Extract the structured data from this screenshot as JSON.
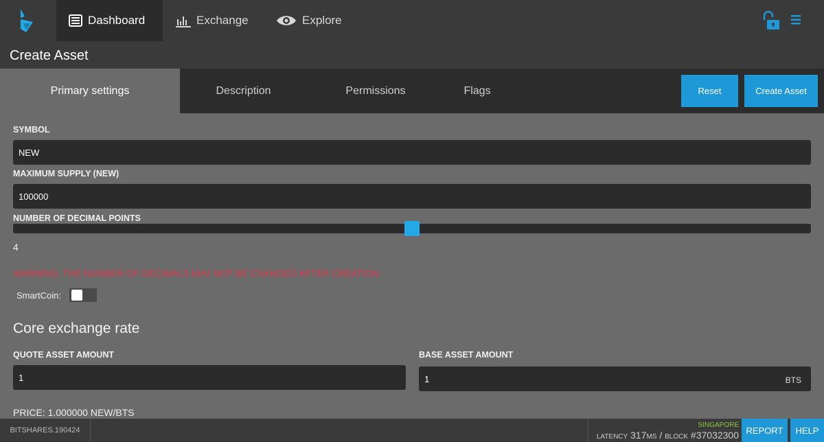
{
  "nav": {
    "items": [
      {
        "label": "Dashboard",
        "icon": "dashboard-icon",
        "active": true
      },
      {
        "label": "Exchange",
        "icon": "exchange-chart-icon",
        "active": false
      },
      {
        "label": "Explore",
        "icon": "eye-icon",
        "active": false
      }
    ],
    "lock_icon": "unlocked-padlock-icon",
    "menu_icon": "hamburger-menu-icon"
  },
  "page": {
    "title": "Create Asset"
  },
  "tabs": [
    {
      "label": "Primary settings",
      "active": true
    },
    {
      "label": "Description",
      "active": false
    },
    {
      "label": "Permissions",
      "active": false
    },
    {
      "label": "Flags",
      "active": false
    }
  ],
  "actions": {
    "reset": "Reset",
    "create": "Create Asset"
  },
  "form": {
    "symbol": {
      "label": "SYMBOL",
      "value": "NEW"
    },
    "max_supply": {
      "label": "MAXIMUM SUPPLY (NEW)",
      "value": "100000"
    },
    "decimals": {
      "label": "NUMBER OF DECIMAL POINTS",
      "value": "4",
      "slider_fraction": 0.5
    },
    "warning": "WARNING: THE NUMBER OF DECIMALS MAY NOT BE CHANGED AFTER CREATION",
    "smartcoin": {
      "label": "SmartCoin:",
      "enabled": false
    }
  },
  "core_exchange": {
    "title": "Core exchange rate",
    "quote": {
      "label": "QUOTE ASSET AMOUNT",
      "value": "1"
    },
    "base": {
      "label": "BASE ASSET AMOUNT",
      "value": "1",
      "unit": "BTS"
    },
    "price": "PRICE: 1.000000 NEW/BTS"
  },
  "footer": {
    "version": "BITSHARES.190424",
    "node": "SINGAPORE",
    "latency_label": "LATENCY",
    "latency_value": "317",
    "latency_unit": "MS",
    "separator": "/",
    "block_label": "BLOCK",
    "block_value": "#37032300",
    "report": "REPORT",
    "help": "HELP"
  },
  "colors": {
    "accent": "#1e98d6",
    "warning": "#e0384c",
    "node_online": "#8cc63f",
    "logo": "#22a9e6"
  }
}
